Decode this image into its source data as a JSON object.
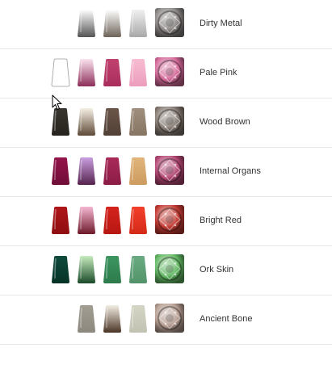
{
  "recipes": [
    {
      "name": "Dirty Metal",
      "pots": [
        {
          "slot": 1,
          "type": "shade",
          "top": "#ffffff",
          "bottom": "#555555"
        },
        {
          "slot": 2,
          "type": "base",
          "top": "#ffffff",
          "bottom": "#6e6459"
        },
        {
          "slot": 3,
          "type": "base",
          "top": "#f0f0f0",
          "bottom": "#a8a8a8"
        }
      ],
      "swatch_color": "#8a8684"
    },
    {
      "name": "Pale Pink",
      "pots": [
        {
          "slot": 0,
          "type": "empty",
          "top": "#ffffff",
          "bottom": "#ffffff"
        },
        {
          "slot": 1,
          "type": "shade",
          "top": "#fbe3ef",
          "bottom": "#8b2e59"
        },
        {
          "slot": 2,
          "type": "base",
          "top": "#c1416e",
          "bottom": "#a92e5d"
        },
        {
          "slot": 3,
          "type": "base",
          "top": "#f7bcd2",
          "bottom": "#ec9dbc"
        }
      ],
      "swatch_color": "#d56a9a"
    },
    {
      "name": "Wood Brown",
      "pots": [
        {
          "slot": 0,
          "type": "base",
          "top": "#3a362f",
          "bottom": "#26231e"
        },
        {
          "slot": 1,
          "type": "shade",
          "top": "#f6efe4",
          "bottom": "#5e4a38"
        },
        {
          "slot": 2,
          "type": "base",
          "top": "#6b5549",
          "bottom": "#524036"
        },
        {
          "slot": 3,
          "type": "base",
          "top": "#a18f7d",
          "bottom": "#877563"
        }
      ],
      "swatch_color": "#857a72"
    },
    {
      "name": "Internal Organs",
      "pots": [
        {
          "slot": 0,
          "type": "base",
          "top": "#95144b",
          "bottom": "#6f0d37"
        },
        {
          "slot": 1,
          "type": "shade",
          "top": "#c99ee0",
          "bottom": "#55234e"
        },
        {
          "slot": 2,
          "type": "base",
          "top": "#a92a58",
          "bottom": "#8b1c45"
        },
        {
          "slot": 3,
          "type": "base",
          "top": "#e1b57b",
          "bottom": "#cc9b5f"
        }
      ],
      "swatch_color": "#b44674"
    },
    {
      "name": "Bright Red",
      "pots": [
        {
          "slot": 0,
          "type": "base",
          "top": "#b01518",
          "bottom": "#8e0e11"
        },
        {
          "slot": 1,
          "type": "shade",
          "top": "#f5b6d2",
          "bottom": "#6d1a2a"
        },
        {
          "slot": 2,
          "type": "base",
          "top": "#d5231d",
          "bottom": "#b81712"
        },
        {
          "slot": 3,
          "type": "base",
          "top": "#f23f2b",
          "bottom": "#d42a18"
        }
      ],
      "swatch_color": "#c33a33"
    },
    {
      "name": "Ork Skin",
      "pots": [
        {
          "slot": 0,
          "type": "base",
          "top": "#0e4a3c",
          "bottom": "#063326"
        },
        {
          "slot": 1,
          "type": "shade",
          "top": "#c5ecbd",
          "bottom": "#1c4a2a"
        },
        {
          "slot": 2,
          "type": "base",
          "top": "#3d9560",
          "bottom": "#2d7b4b"
        },
        {
          "slot": 3,
          "type": "base",
          "top": "#6aab82",
          "bottom": "#53936a"
        }
      ],
      "swatch_color": "#62b863"
    },
    {
      "name": "Ancient Bone",
      "pots": [
        {
          "slot": 1,
          "type": "base",
          "top": "#a19d92",
          "bottom": "#8c887d"
        },
        {
          "slot": 2,
          "type": "shade",
          "top": "#f3eee4",
          "bottom": "#4a3526"
        },
        {
          "slot": 3,
          "type": "base",
          "top": "#d5d5c6",
          "bottom": "#c2c2b2"
        }
      ],
      "swatch_color": "#b79e92"
    }
  ],
  "cursor": {
    "icon": "mouse-pointer-icon"
  }
}
